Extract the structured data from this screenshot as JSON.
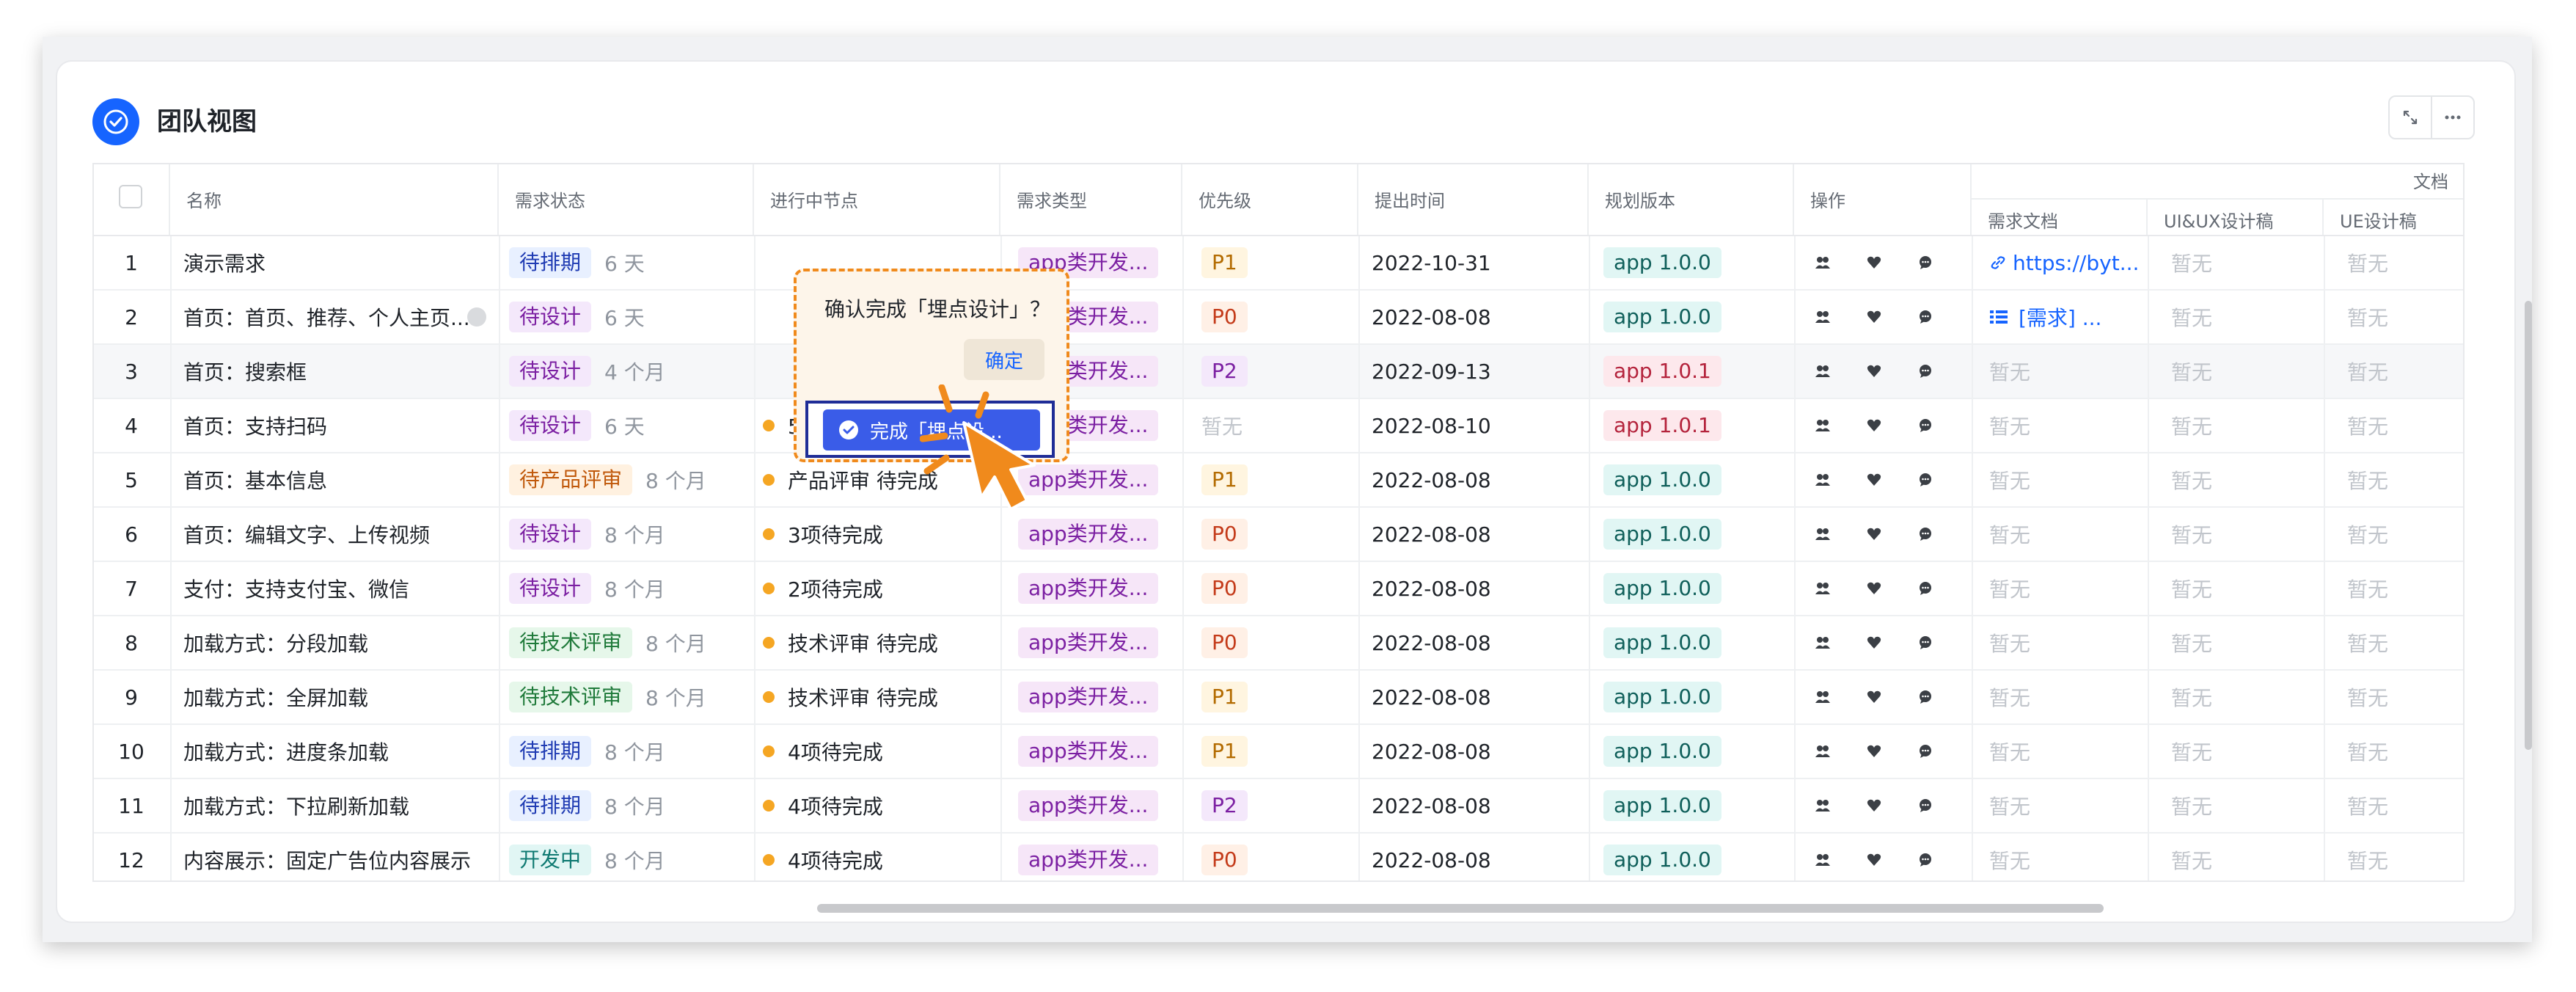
{
  "header": {
    "title": "团队视图"
  },
  "columns": {
    "name": "名称",
    "status": "需求状态",
    "node": "进行中节点",
    "type": "需求类型",
    "priority": "优先级",
    "date": "提出时间",
    "version": "规划版本",
    "ops": "操作",
    "docs_group": "文档",
    "doc": "需求文档",
    "uiux": "UI&UX设计稿",
    "ue": "UE设计稿"
  },
  "rows": [
    {
      "idx": "1",
      "name": "演示需求",
      "status": "待排期",
      "ago": "6 天",
      "node": "",
      "type": "app类开发...",
      "priority": "P1",
      "date": "2022-10-31",
      "version": "app 1.0.0",
      "doc": "https://byt...",
      "uiux": "暂无",
      "ue": "暂无"
    },
    {
      "idx": "2",
      "name": "首页：首页、推荐、个人主页...",
      "status": "待设计",
      "ago": "6 天",
      "node": "",
      "type": "app类开发...",
      "priority": "P0",
      "date": "2022-08-08",
      "version": "app 1.0.0",
      "doc": "[需求] ...",
      "uiux": "暂无",
      "ue": "暂无"
    },
    {
      "idx": "3",
      "name": "首页：搜索框",
      "status": "待设计",
      "ago": "4 个月",
      "node": "",
      "type": "app类开发...",
      "priority": "P2",
      "date": "2022-09-13",
      "version": "app 1.0.1",
      "doc": "暂无",
      "uiux": "暂无",
      "ue": "暂无"
    },
    {
      "idx": "4",
      "name": "首页：支持扫码",
      "status": "待设计",
      "ago": "6 天",
      "node": "5项待完成",
      "type": "app类开发...",
      "priority": "暂无",
      "date": "2022-08-10",
      "version": "app 1.0.1",
      "doc": "暂无",
      "uiux": "暂无",
      "ue": "暂无"
    },
    {
      "idx": "5",
      "name": "首页：基本信息",
      "status": "待产品评审",
      "ago": "8 个月",
      "node": "产品评审 待完成",
      "type": "app类开发...",
      "priority": "P1",
      "date": "2022-08-08",
      "version": "app 1.0.0",
      "doc": "暂无",
      "uiux": "暂无",
      "ue": "暂无"
    },
    {
      "idx": "6",
      "name": "首页：编辑文字、上传视频",
      "status": "待设计",
      "ago": "8 个月",
      "node": "3项待完成",
      "type": "app类开发...",
      "priority": "P0",
      "date": "2022-08-08",
      "version": "app 1.0.0",
      "doc": "暂无",
      "uiux": "暂无",
      "ue": "暂无"
    },
    {
      "idx": "7",
      "name": "支付：支持支付宝、微信",
      "status": "待设计",
      "ago": "8 个月",
      "node": "2项待完成",
      "type": "app类开发...",
      "priority": "P0",
      "date": "2022-08-08",
      "version": "app 1.0.0",
      "doc": "暂无",
      "uiux": "暂无",
      "ue": "暂无"
    },
    {
      "idx": "8",
      "name": "加载方式：分段加载",
      "status": "待技术评审",
      "ago": "8 个月",
      "node": "技术评审 待完成",
      "type": "app类开发...",
      "priority": "P0",
      "date": "2022-08-08",
      "version": "app 1.0.0",
      "doc": "暂无",
      "uiux": "暂无",
      "ue": "暂无"
    },
    {
      "idx": "9",
      "name": "加载方式：全屏加载",
      "status": "待技术评审",
      "ago": "8 个月",
      "node": "技术评审 待完成",
      "type": "app类开发...",
      "priority": "P1",
      "date": "2022-08-08",
      "version": "app 1.0.0",
      "doc": "暂无",
      "uiux": "暂无",
      "ue": "暂无"
    },
    {
      "idx": "10",
      "name": "加载方式：进度条加载",
      "status": "待排期",
      "ago": "8 个月",
      "node": "4项待完成",
      "type": "app类开发...",
      "priority": "P1",
      "date": "2022-08-08",
      "version": "app 1.0.0",
      "doc": "暂无",
      "uiux": "暂无",
      "ue": "暂无"
    },
    {
      "idx": "11",
      "name": "加载方式：下拉刷新加载",
      "status": "待排期",
      "ago": "8 个月",
      "node": "4项待完成",
      "type": "app类开发...",
      "priority": "P2",
      "date": "2022-08-08",
      "version": "app 1.0.0",
      "doc": "暂无",
      "uiux": "暂无",
      "ue": "暂无"
    },
    {
      "idx": "12",
      "name": "内容展示：固定广告位内容展示",
      "status": "开发中",
      "ago": "8 个月",
      "node": "4项待完成",
      "type": "app类开发...",
      "priority": "P0",
      "date": "2022-08-08",
      "version": "app 1.0.0",
      "doc": "暂无",
      "uiux": "暂无",
      "ue": "暂无"
    }
  ],
  "popup": {
    "text": "确认完成「埋点设计」？",
    "confirm": "确定"
  },
  "complete_button": "完成「埋点设...",
  "colors": {
    "accent": "#1664ff",
    "status_pending_schedule": "#e8f0ff",
    "status_design": "#f4e8fb",
    "status_product_review": "#fff1e0",
    "status_tech_review": "#e6f7ea",
    "status_dev": "#e1f6f4",
    "type_bg": "#f6e6f8",
    "version_100": "#e1f6f4",
    "version_101": "#fde8ec",
    "highlight_orange": "#f08a1c"
  }
}
